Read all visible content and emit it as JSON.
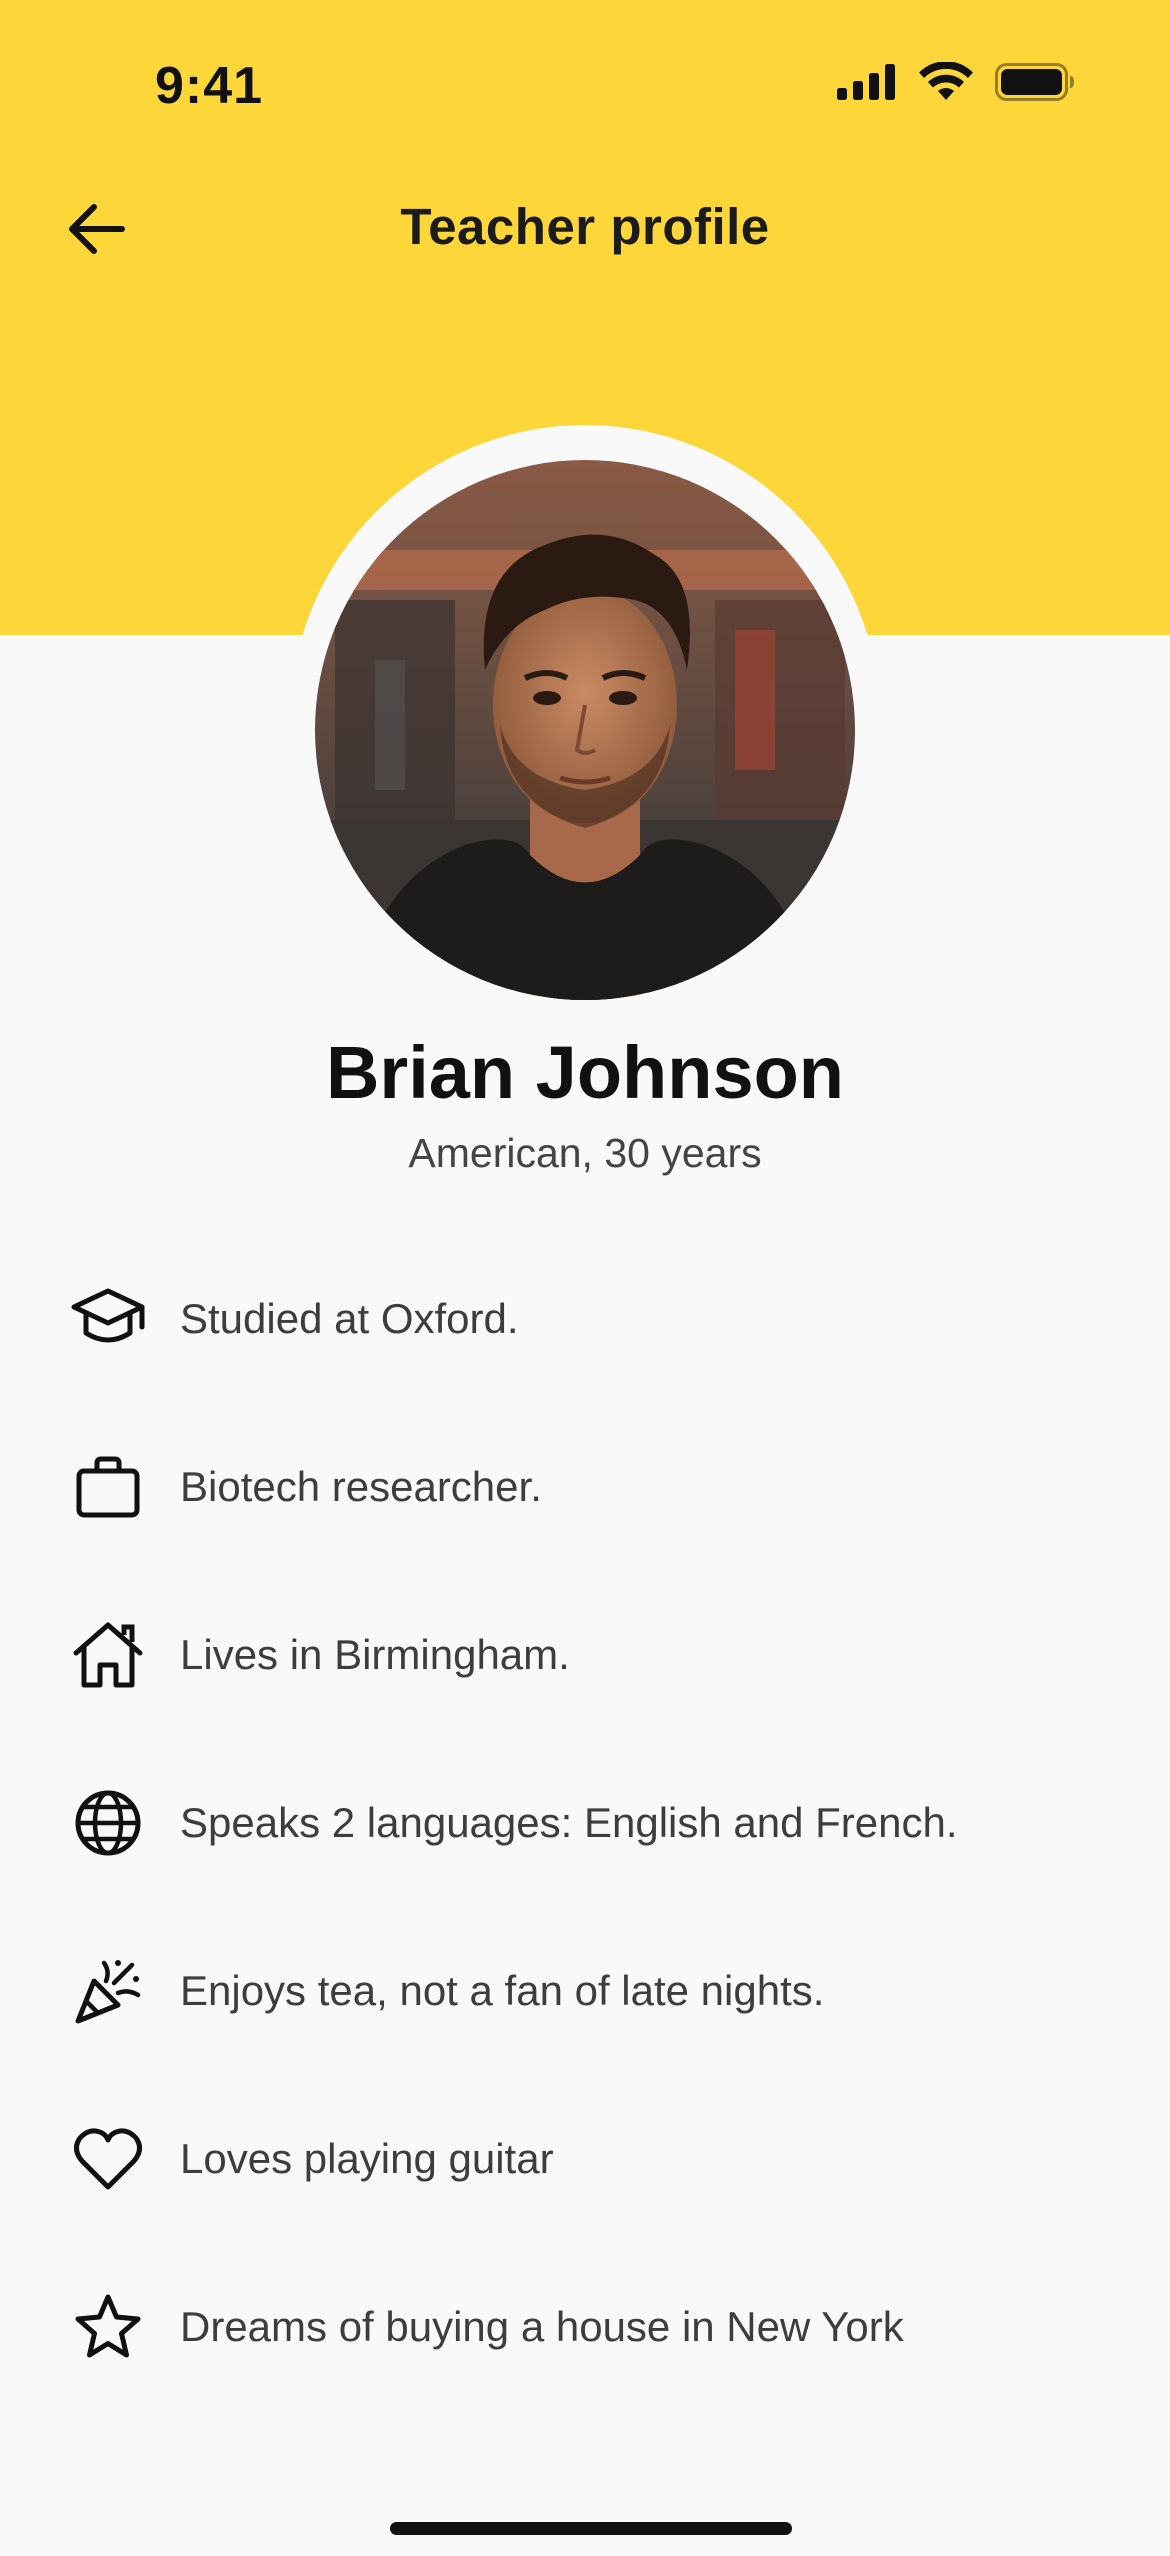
{
  "status_bar": {
    "time": "9:41"
  },
  "nav": {
    "title": "Teacher profile"
  },
  "profile": {
    "name": "Brian Johnson",
    "subtitle": "American, 30 years"
  },
  "facts": [
    {
      "icon": "graduation-cap-icon",
      "text": "Studied at Oxford."
    },
    {
      "icon": "briefcase-icon",
      "text": "Biotech researcher."
    },
    {
      "icon": "home-icon",
      "text": "Lives in Birmingham."
    },
    {
      "icon": "globe-icon",
      "text": "Speaks 2 languages: English and French."
    },
    {
      "icon": "party-popper-icon",
      "text": "Enjoys tea, not a fan of late nights."
    },
    {
      "icon": "heart-icon",
      "text": "Loves playing guitar"
    },
    {
      "icon": "star-icon",
      "text": "Dreams of buying a house in New York"
    }
  ],
  "colors": {
    "header_bg": "#FDD73A",
    "page_bg": "#F9F9F9",
    "text_primary": "#111111",
    "text_secondary": "#3D3D3D"
  }
}
